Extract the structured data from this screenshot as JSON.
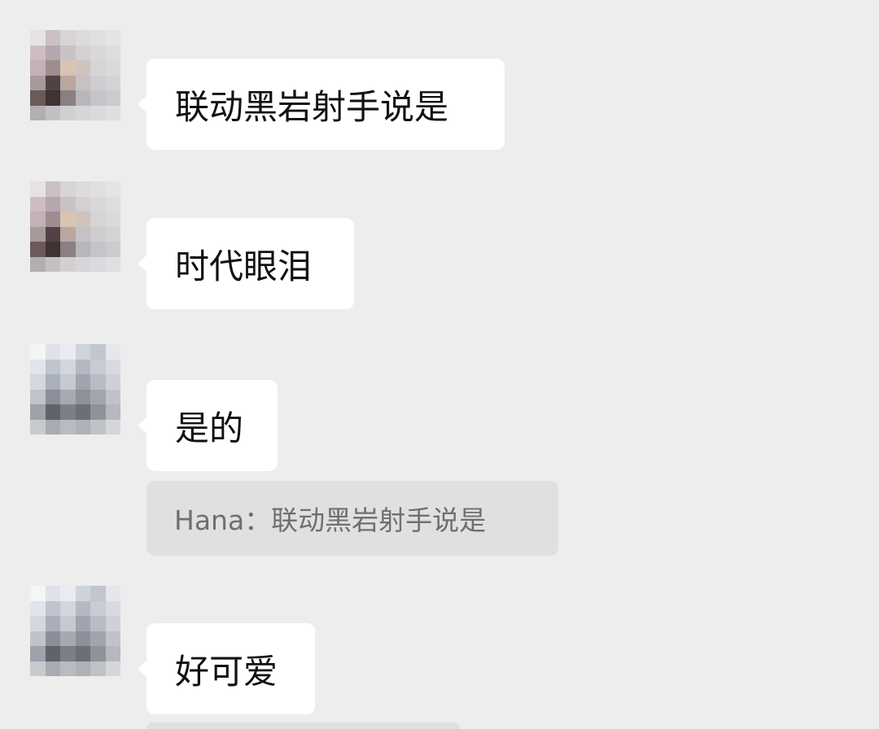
{
  "messages": [
    {
      "text": "联动黑岩射手说是",
      "avatar_style": "warm"
    },
    {
      "text": "时代眼泪",
      "avatar_style": "warm"
    },
    {
      "text": "是的",
      "avatar_style": "cool",
      "quote": "Hana：联动黑岩射手说是"
    },
    {
      "text": "好可爱",
      "avatar_style": "cool"
    }
  ],
  "colors": {
    "background": "#ededed",
    "bubble": "#ffffff",
    "quote_bg": "#e0e0e0",
    "quote_text": "#6f6f6f"
  }
}
